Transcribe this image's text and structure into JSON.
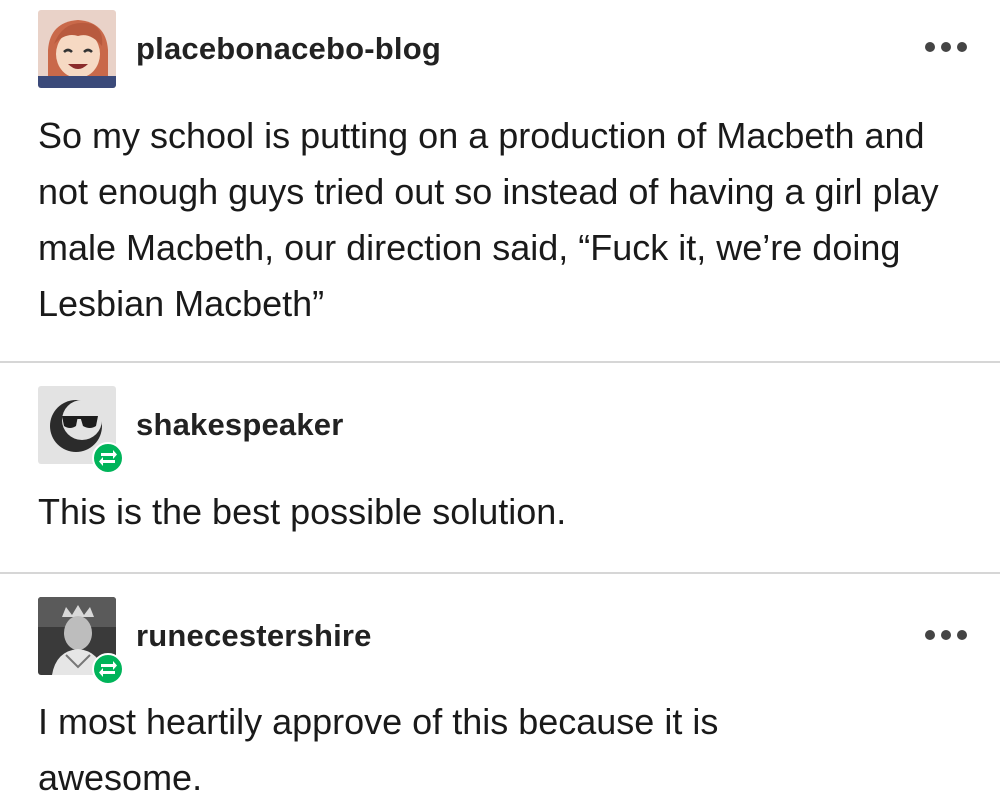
{
  "posts": [
    {
      "username": "placebonacebo-blog",
      "text": "So my school is putting on a production of Macbeth and not enough guys tried out so instead of having a girl play male Macbeth, our direction said, “Fuck it, we’re doing Lesbian Macbeth”",
      "has_menu": true,
      "reblog_badge": false,
      "avatar_icon": "anime-character-avatar"
    },
    {
      "username": "shakespeaker",
      "text": "This is the best possible solution.",
      "has_menu": false,
      "reblog_badge": true,
      "avatar_icon": "sunglasses-face-avatar"
    },
    {
      "username": "runecestershire",
      "text": "I most heartily approve of this because it is awesome.",
      "has_menu": true,
      "reblog_badge": true,
      "avatar_icon": "crowned-figure-avatar"
    }
  ],
  "colors": {
    "reblog_green": "#00b45a",
    "divider": "#d6d6d6",
    "text": "#1a1a1a"
  }
}
